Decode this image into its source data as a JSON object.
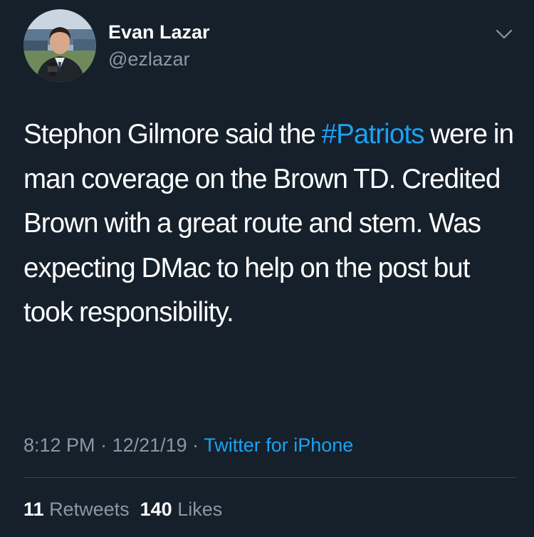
{
  "author": {
    "display_name": "Evan Lazar",
    "handle": "@ezlazar",
    "avatar_icon": "profile-photo"
  },
  "menu": {
    "icon": "chevron-down-icon"
  },
  "tweet": {
    "text_before_hashtag": "Stephon Gilmore said the ",
    "hashtag": "#Patriots",
    "text_after_hashtag": " were in man coverage on the Brown TD. Credited Brown with a great route and stem. Was expecting DMac to help on the post but took responsibility."
  },
  "meta": {
    "time": "8:12 PM",
    "separator": " · ",
    "date": "12/21/19",
    "source": "Twitter for iPhone"
  },
  "stats": {
    "retweets_count": "11",
    "retweets_label": "Retweets",
    "likes_count": "140",
    "likes_label": "Likes"
  },
  "colors": {
    "background": "#15202b",
    "text": "#ffffff",
    "secondary": "#8899a6",
    "link": "#1da1f2",
    "divider": "#38444d"
  }
}
